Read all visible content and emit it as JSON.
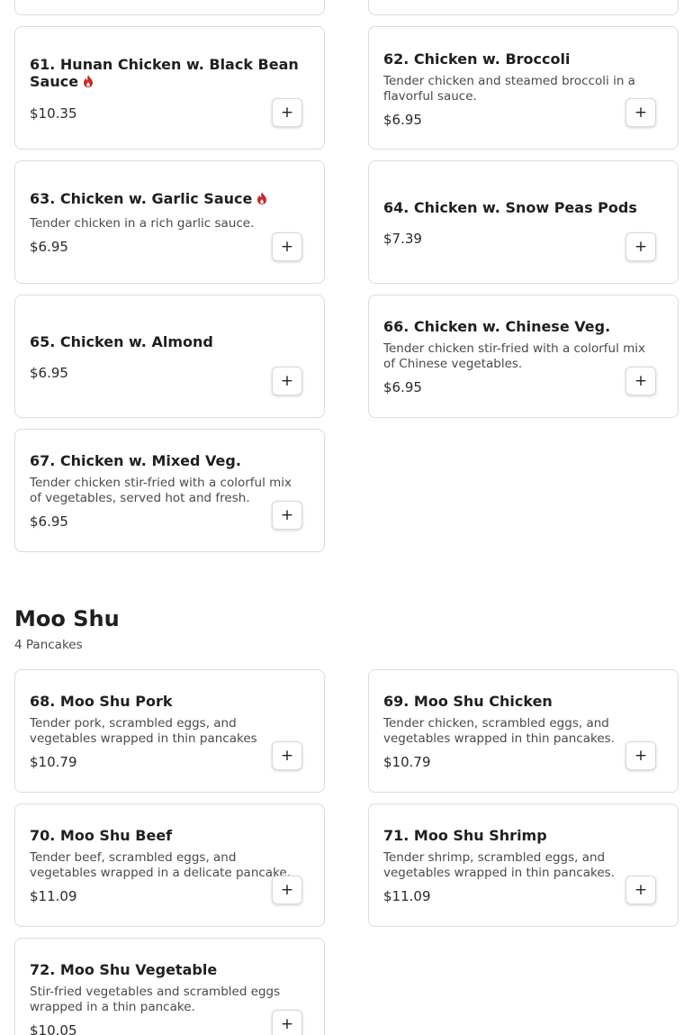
{
  "top_section": {
    "items": [
      {
        "title": "61. Hunan Chicken w. Black Bean Sauce",
        "title_lines": [
          "61. Hunan Chicken w. Black Bean",
          "Sauce"
        ],
        "description_lines": [],
        "price": "$10.35",
        "spicy": true,
        "add_label": "+"
      },
      {
        "title": "62. Chicken w. Broccoli",
        "description_lines": [
          "Tender chicken and steamed broccoli in a",
          "flavorful sauce."
        ],
        "price": "$6.95",
        "spicy": false,
        "add_label": "+"
      },
      {
        "title": "63. Chicken w. Garlic Sauce",
        "description_lines": [
          "Tender chicken in a rich garlic sauce."
        ],
        "price": "$6.95",
        "spicy": true,
        "add_label": "+"
      },
      {
        "title": "64. Chicken w. Snow Peas Pods",
        "description_lines": [],
        "price": "$7.39",
        "spicy": false,
        "add_label": "+"
      },
      {
        "title": "65. Chicken w. Almond",
        "description_lines": [],
        "price": "$6.95",
        "spicy": false,
        "add_label": "+"
      },
      {
        "title": "66. Chicken w. Chinese Veg.",
        "description_lines": [
          "Tender chicken stir-fried with a colorful mix",
          "of Chinese vegetables."
        ],
        "price": "$6.95",
        "spicy": false,
        "add_label": "+"
      },
      {
        "title": "67. Chicken w. Mixed Veg.",
        "description_lines": [
          "Tender chicken stir-fried with a colorful mix",
          "of vegetables, served hot and fresh."
        ],
        "price": "$6.95",
        "spicy": false,
        "add_label": "+"
      }
    ]
  },
  "moo_shu": {
    "title": "Moo Shu",
    "subtitle": "4 Pancakes",
    "items": [
      {
        "title": "68. Moo Shu Pork",
        "description_lines": [
          "Tender pork, scrambled eggs, and",
          "vegetables wrapped in thin pancakes"
        ],
        "price": "$10.79",
        "add_label": "+"
      },
      {
        "title": "69. Moo Shu Chicken",
        "description_lines": [
          "Tender chicken, scrambled eggs, and",
          "vegetables wrapped in thin pancakes."
        ],
        "price": "$10.79",
        "add_label": "+"
      },
      {
        "title": "70. Moo Shu Beef",
        "description_lines": [
          "Tender beef, scrambled eggs, and",
          "vegetables wrapped in a delicate pancake."
        ],
        "price": "$11.09",
        "add_label": "+"
      },
      {
        "title": "71. Moo Shu Shrimp",
        "description_lines": [
          "Tender shrimp, scrambled eggs, and",
          "vegetables wrapped in thin pancakes."
        ],
        "price": "$11.09",
        "add_label": "+"
      },
      {
        "title": "72. Moo Shu Vegetable",
        "description_lines": [
          "Stir-fried vegetables and scrambled eggs",
          "wrapped in a thin pancake."
        ],
        "price": "$10.05",
        "add_label": "+"
      }
    ]
  },
  "colors": {
    "spicy": "#c62828",
    "border": "#dcdcdc",
    "text": "#1f1f1f"
  },
  "icons": {
    "spicy": "flame-icon",
    "add": "plus-icon"
  }
}
